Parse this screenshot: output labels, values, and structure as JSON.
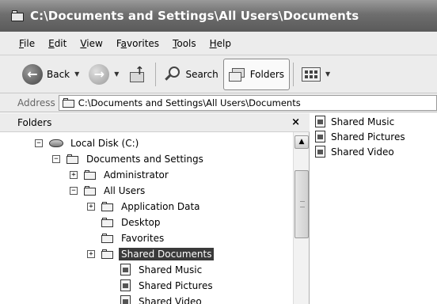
{
  "window": {
    "title": "C:\\Documents and Settings\\All Users\\Documents",
    "title_icon": "folder-icon"
  },
  "menu": {
    "items": [
      {
        "label": "File",
        "accel": "F"
      },
      {
        "label": "Edit",
        "accel": "E"
      },
      {
        "label": "View",
        "accel": "V"
      },
      {
        "label": "Favorites",
        "accel": "a"
      },
      {
        "label": "Tools",
        "accel": "T"
      },
      {
        "label": "Help",
        "accel": "H"
      }
    ]
  },
  "toolbar": {
    "back_label": "Back",
    "search_label": "Search",
    "folders_label": "Folders"
  },
  "address": {
    "label": "Address",
    "value": "C:\\Documents and Settings\\All Users\\Documents"
  },
  "folders_pane": {
    "header": "Folders",
    "close": "×",
    "tree": [
      {
        "label": "Local Disk (C:)",
        "expander": "−",
        "icon": "disk"
      },
      {
        "label": "Documents and Settings",
        "expander": "−",
        "icon": "folder"
      },
      {
        "label": "Administrator",
        "expander": "+",
        "icon": "folder"
      },
      {
        "label": "All Users",
        "expander": "−",
        "icon": "folder"
      },
      {
        "label": "Application Data",
        "expander": "+",
        "icon": "folder"
      },
      {
        "label": "Desktop",
        "expander": "",
        "icon": "folder"
      },
      {
        "label": "Favorites",
        "expander": "",
        "icon": "folder"
      },
      {
        "label": "Shared Documents",
        "expander": "+",
        "icon": "folder-open",
        "selected": true
      },
      {
        "label": "Shared Music",
        "expander": "",
        "icon": "music-file"
      },
      {
        "label": "Shared Pictures",
        "expander": "",
        "icon": "pictures-file"
      },
      {
        "label": "Shared Video",
        "expander": "",
        "icon": "video-file"
      }
    ]
  },
  "content": {
    "items": [
      {
        "label": "Shared Music",
        "icon": "music-file"
      },
      {
        "label": "Shared Pictures",
        "icon": "pictures-file"
      },
      {
        "label": "Shared Video",
        "icon": "video-file"
      }
    ]
  }
}
